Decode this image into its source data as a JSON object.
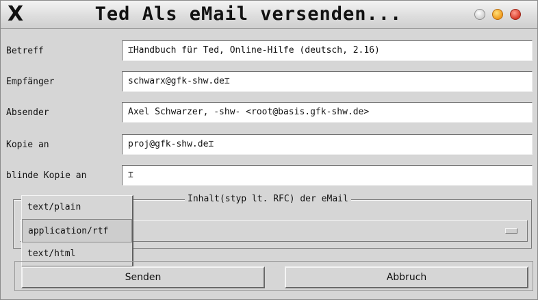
{
  "window": {
    "title": "Ted Als eMail versenden...",
    "close_glyph": "X",
    "controls": [
      "minimize",
      "maximize",
      "close"
    ]
  },
  "fields": [
    {
      "label": "Betreff",
      "value": "Handbuch für Ted, Online-Hilfe (deutsch, 2.16)"
    },
    {
      "label": "Empfänger",
      "value": "schwarx@gfk-shw.de"
    },
    {
      "label": "Absender",
      "value": "Axel Schwarzer, -shw- <root@basis.gfk-shw.de>"
    },
    {
      "label": "Kopie an",
      "value": "proj@gfk-shw.de"
    },
    {
      "label": "blinde Kopie an",
      "value": ""
    }
  ],
  "content_type": {
    "group_title": "Inhalt(styp lt. RFC) der eMail",
    "options": [
      "text/plain",
      "application/rtf",
      "text/html"
    ],
    "selected": "application/rtf"
  },
  "buttons": {
    "send": "Senden",
    "cancel": "Abbruch"
  }
}
